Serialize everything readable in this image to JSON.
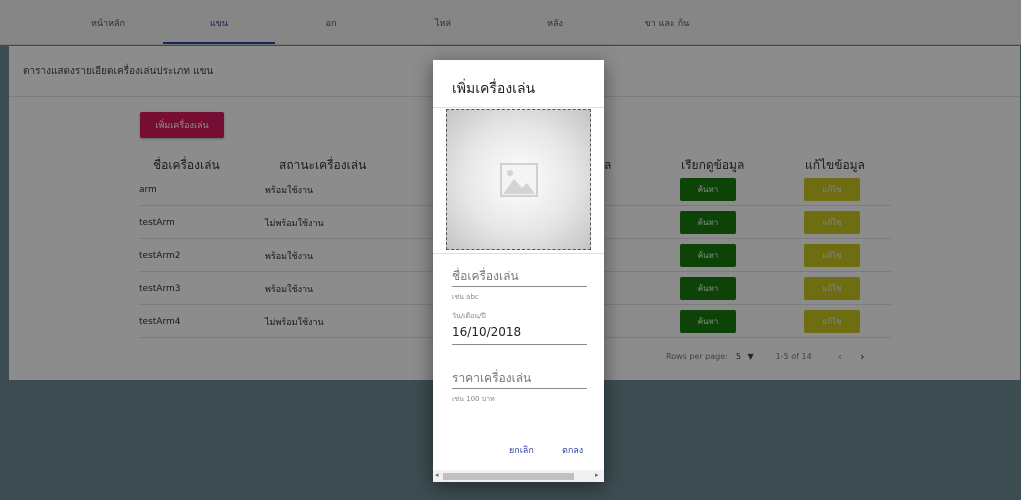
{
  "tabs": [
    {
      "label": "หน้าหลัก"
    },
    {
      "label": "แขน"
    },
    {
      "label": "อก"
    },
    {
      "label": "ไหล่"
    },
    {
      "label": "หลัง"
    },
    {
      "label": "ขา และ ก้น"
    }
  ],
  "card": {
    "title": "ตารางแสดงรายเอียดเครื่องเล่นประเภท แขน",
    "add_button": "เพิ่มเครื่องเล่น"
  },
  "table": {
    "headers": [
      "ชื่อเครื่องเล่น",
      "สถานะเครื่องเล่น",
      "ล",
      "เรียกดูข้อมูล",
      "แก้ไขข้อมูล"
    ],
    "rows": [
      {
        "name": "arm",
        "status": "พร้อมใช้งาน",
        "search": "ค้นหา",
        "edit": "แก้ไข"
      },
      {
        "name": "testArm",
        "status": "ไม่พร้อมใช้งาน",
        "search": "ค้นหา",
        "edit": "แก้ไข"
      },
      {
        "name": "testArm2",
        "status": "พร้อมใช้งาน",
        "search": "ค้นหา",
        "edit": "แก้ไข"
      },
      {
        "name": "testArm3",
        "status": "พร้อมใช้งาน",
        "search": "ค้นหา",
        "edit": "แก้ไข"
      },
      {
        "name": "testArm4",
        "status": "ไม่พร้อมใช้งาน",
        "search": "ค้นหา",
        "edit": "แก้ไข"
      }
    ]
  },
  "pager": {
    "rows_label": "Rows per page:",
    "rows_value": "5",
    "range": "1-5 of 14"
  },
  "dialog": {
    "title": "เพิ่มเครื่องเล่น",
    "name_label": "ชื่อเครื่องเล่น",
    "name_hint": "เช่น abc",
    "date_label": "วัน/เดือน/ปี",
    "date_value": "16/10/2018",
    "price_label": "ราคาเครื่องเล่น",
    "price_hint": "เช่น 100 บาท",
    "cancel": "ยกเลิก",
    "ok": "ตกลง"
  },
  "icons": [
    "image-placeholder-icon",
    "chevron-left-icon",
    "chevron-right-icon",
    "dropdown-arrow-icon"
  ],
  "colors": {
    "primary": "#2b44a8",
    "add_button": "#d81b60",
    "search_button": "#1a7a10",
    "edit_button": "#cbc61f"
  }
}
